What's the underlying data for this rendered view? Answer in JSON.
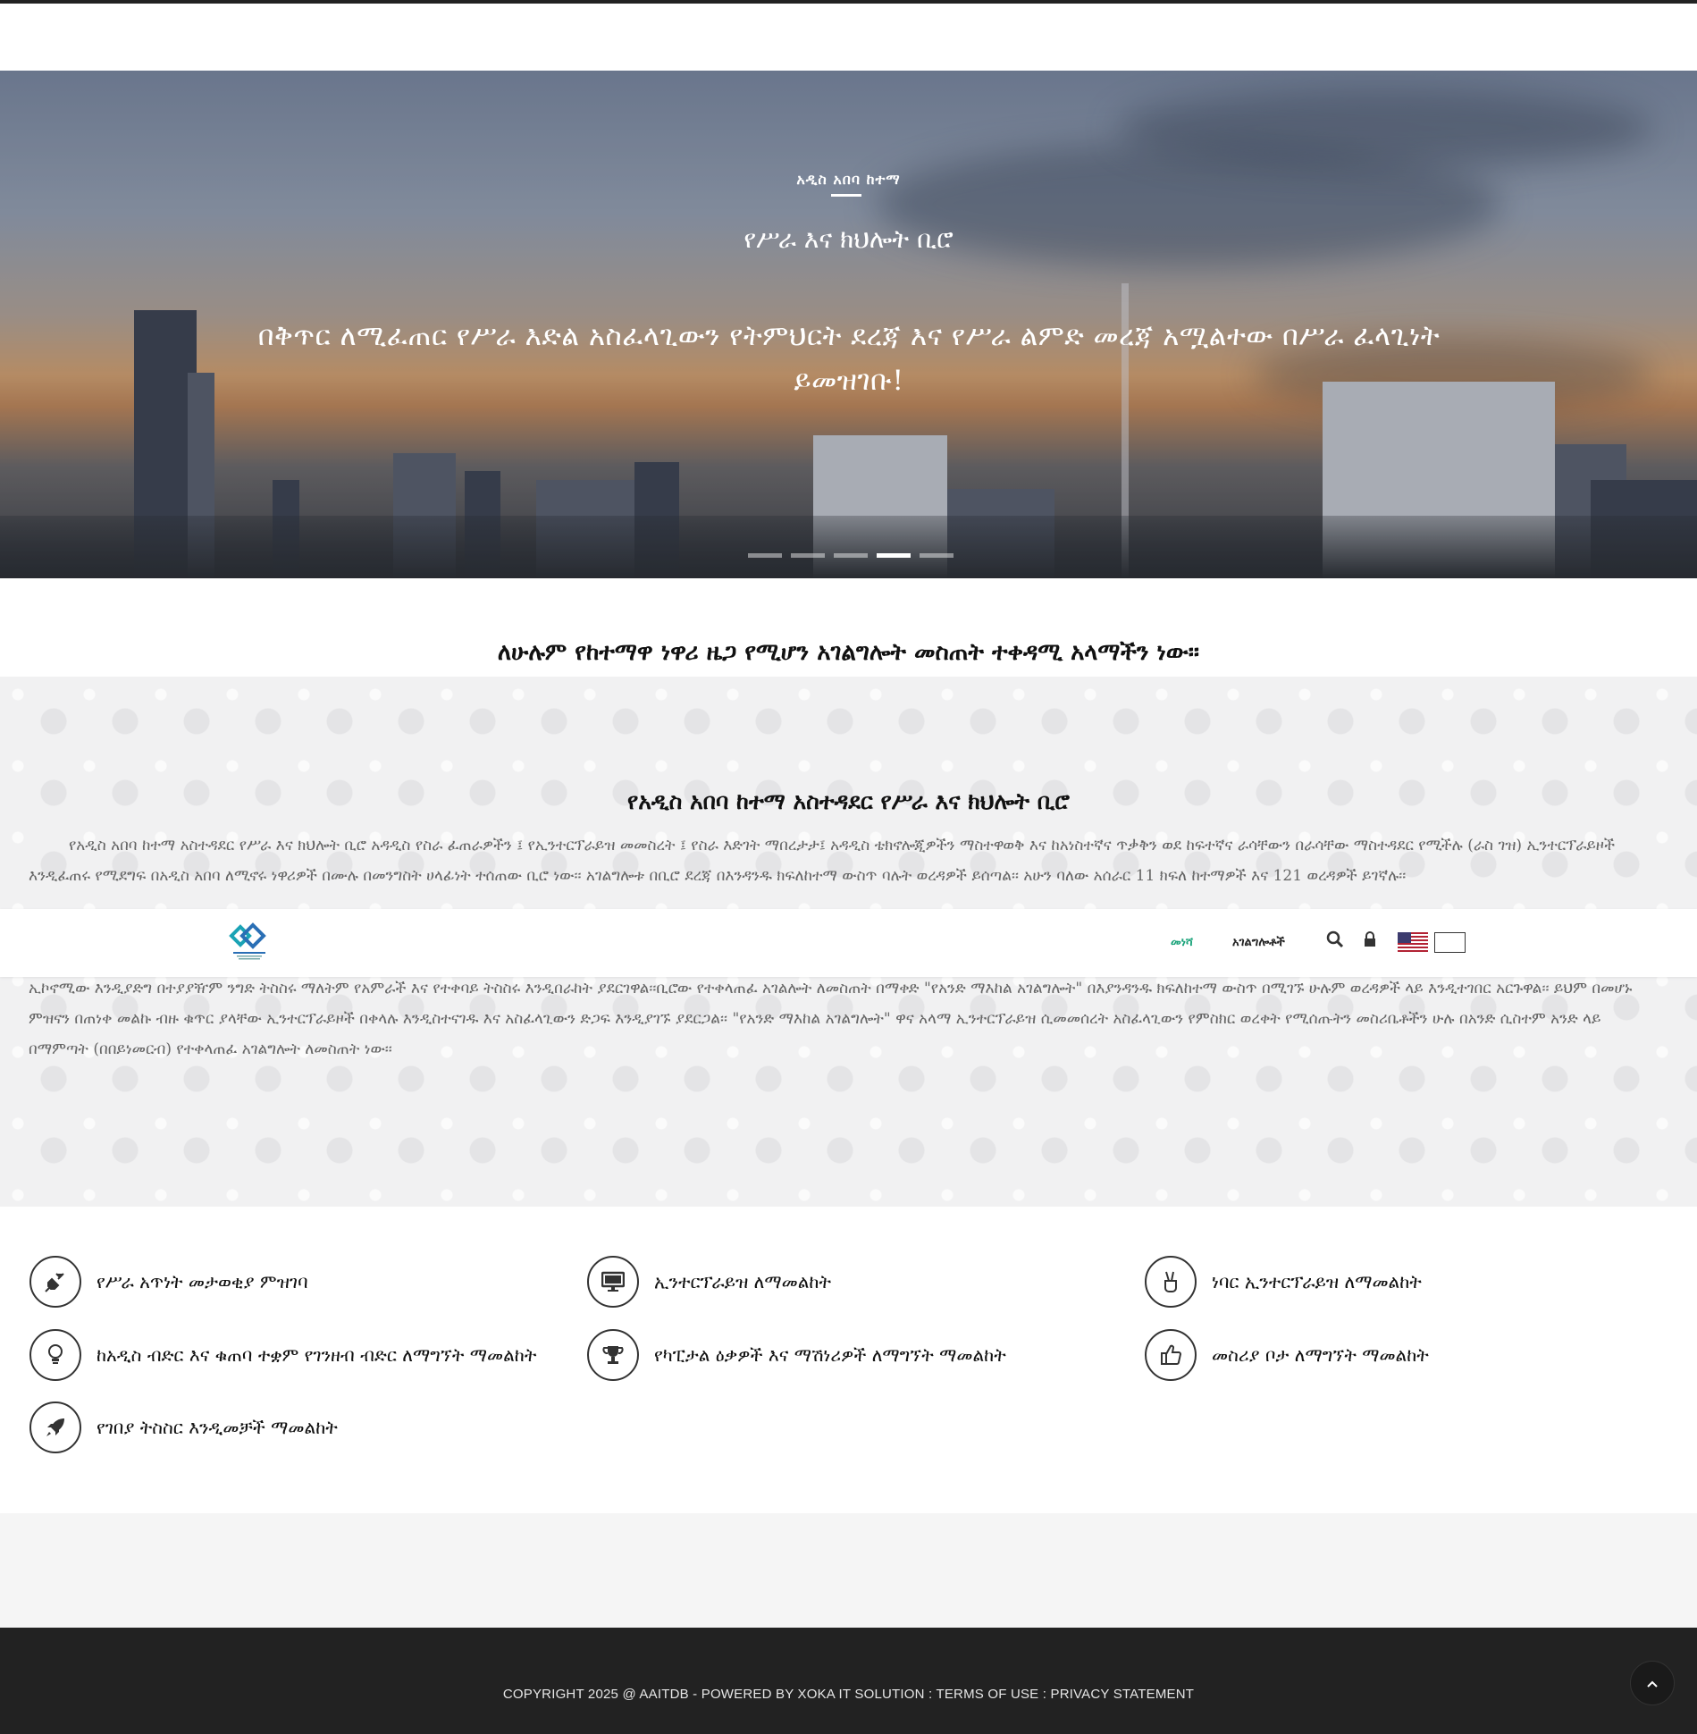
{
  "hero": {
    "eyebrow": "አዲስ አበባ ከተማ",
    "title": "የሥራ እና ክህሎት ቢሮ",
    "text": "በቅጥር ለሚፈጠር የሥራ እድል አስፈላጊውን የትምህርት ደረጃ እና የሥራ ልምድ መረጃ አሟልተው በሥራ ፈላጊነት ይመዝገቡ!",
    "slides": 5,
    "active_slide": 4
  },
  "mission": "ለሁሉም የከተማዋ ነዋሪ ዜጋ የሚሆን አገልግሎት መስጠት ተቀዳሚ አላማችን ነው፡፡",
  "about": {
    "title": "የአዲስ አበባ ከተማ አስተዳደር የሥራ እና ክህሎት ቢሮ",
    "paragraph1": "የአዲስ አበባ ከተማ አስተዳደር የሥራ እና ክህሎት ቢሮ አዳዲስ የስራ ፈጠራዎችን ፤ የኢንተርፕራይዝ መመስረት ፤ የስራ እድገት ማበረታታ፤ አዳዲስ ቴክኖሎጂዎችን ማስተዋወቅ እና ከአነስተኛና ጥቃቅን ወደ ከፍተኛና ራሳቸውን በራሳቸው ማስተዳደር የሚችሉ (ራስ ገዝ) ኢንተርፕራይዞች እንዲፈጠሩ የሚደግፍ በአዲስ አበባ ለሚኖሩ ነዋሪዎች በሙሉ በመንግስት ሀላፊነት ተሰጠው ቢሮ ነው፡፡ አገልግሎቱ በቢሮ ደረጃ በእንዳንዱ ክፍለከተማ ውስጥ ባሉት ወረዳዎች ይሰጣል፡፡ አሁን ባለው አሰራር 11 ክፍለ ከተማዎች እና 121 ወረዳዎች ይገኛሉ፡፡",
    "paragraph2": "ኢኮኖሚው እንዲያድግ በተያያዥም ንግድ ትስስሩ ማለትም የአምራች እና የተቀባይ ትስስሩ እንዲበራከት ያደርገዋል፡፡ቢሮው የተቀላጠፈ አገልሎት ለመስጠት በማቀድ \"የአንድ ማእከል አገልግሎት\" በእያንዳንዱ ክፍለከተማ ውስጥ በሚገኙ ሁሉም ወረዳዎች ላይ እንዲተገበር አርጉዋል፡፡ ይህም በመሆኑ ምዝናን በጠነቀ መልኩ ብዙ ቁጥር ያላቸው ኢንተርፕራይዞች በቀላሉ እንዲስተናገዱ እና አስፈላጊውን ድጋፍ እንዲያገኙ ያደርጋል፡፡ \"የአንድ ማእከል አገልግሎት\" ዋና አላማ ኢንተርፕራይዝ ሲመመሰረት አስፈላጊውን የምስክር ወረቀት የሚሰጡትን መስሪቤቶችን ሁሉ በአንድ ሲስተም አንድ ላይ በማምጣት (በበይነመርብ) የተቀላጠፈ አገልግሎት ለመስጠት ነው፡፡"
  },
  "nav": {
    "home": "መነሻ",
    "services": "አገልግሎቶች",
    "icons": [
      "search-icon",
      "lock-icon",
      "us-flag-icon"
    ]
  },
  "services": [
    {
      "label": "የሥራ አጥነት መታወቂያ ምዝገባ",
      "icon": "plug-icon"
    },
    {
      "label": "ኢንተርፕራይዝ ለማመልከት",
      "icon": "monitor-icon"
    },
    {
      "label": "ነባር ኢንተርፕራይዝ ለማመልከት",
      "icon": "peace-hand-icon"
    },
    {
      "label": "ከአዲስ ብድር እና ቁጠባ ተቋም የገንዘብ ብድር ለማግኘት ማመልከት",
      "icon": "lightbulb-icon"
    },
    {
      "label": "የካፒታል ዕቃዎች እና ማሽነሪዎች ለማግኘት ማመልከት",
      "icon": "trophy-icon"
    },
    {
      "label": "መስሪያ ቦታ ለማግኘት ማመልከት",
      "icon": "thumbs-up-icon"
    },
    {
      "label": "የገበያ ትስስር እንዲመቻች ማመልከት",
      "icon": "rocket-icon"
    }
  ],
  "footer": {
    "text": "COPYRIGHT 2025 @ AAITDB - POWERED BY XOKA IT SOLUTION : TERMS OF USE : PRIVACY STATEMENT"
  },
  "colors": {
    "accent": "#1aa37a",
    "footer_bg": "#222222",
    "about_bg": "#f1f1f2"
  }
}
